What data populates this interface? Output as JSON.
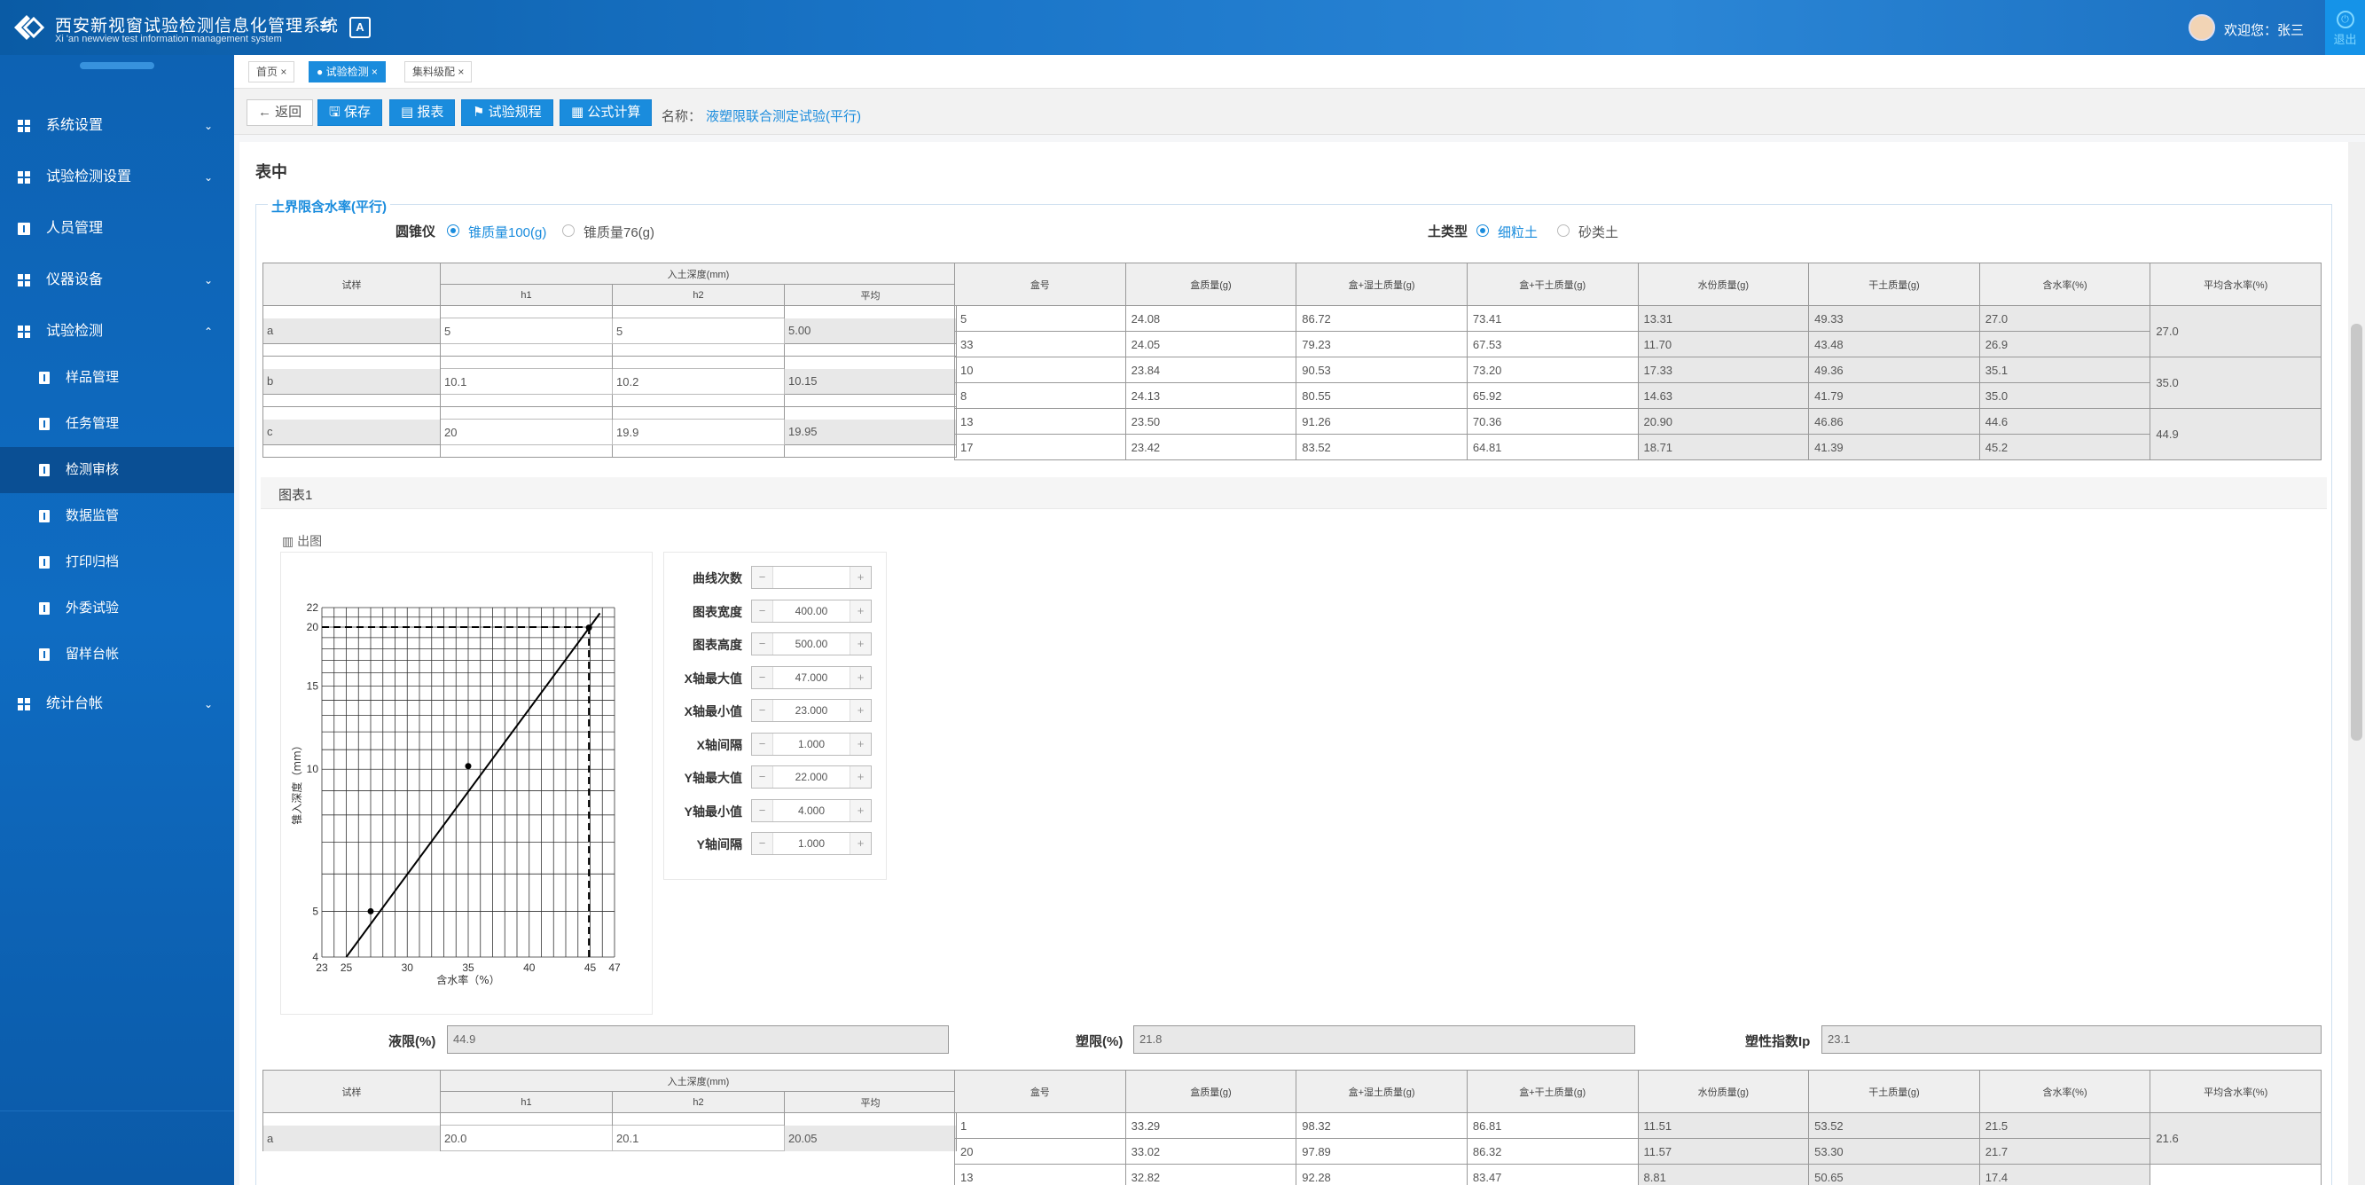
{
  "header": {
    "title": "西安新视窗试验检测信息化管理系统",
    "subtitle": "Xi 'an newview test information management system",
    "font_icon_text": "A",
    "welcome": "欢迎您：张三",
    "logout": "退出"
  },
  "sidebar": {
    "items": [
      {
        "label": "系统设置",
        "icon": "grid-icon",
        "chevron": "⌄"
      },
      {
        "label": "试验检测设置",
        "icon": "grid-icon",
        "chevron": "⌄"
      },
      {
        "label": "人员管理",
        "icon": "info-icon"
      },
      {
        "label": "仪器设备",
        "icon": "grid-icon",
        "chevron": "⌄"
      },
      {
        "label": "试验检测",
        "icon": "grid-icon",
        "chevron": "⌃"
      },
      {
        "label": "统计台帐",
        "icon": "grid-icon",
        "chevron": "⌄"
      }
    ],
    "sub_items": [
      {
        "label": "样品管理"
      },
      {
        "label": "任务管理"
      },
      {
        "label": "检测审核"
      },
      {
        "label": "数据监管"
      },
      {
        "label": "打印归档"
      },
      {
        "label": "外委试验"
      },
      {
        "label": "留样台帐"
      }
    ]
  },
  "tabs": [
    {
      "label": "首页 ×"
    },
    {
      "label": "● 试验检测 ×"
    },
    {
      "label": "集料级配 ×"
    }
  ],
  "toolbar": {
    "back": "← 返回",
    "save": "保存",
    "report": "报表",
    "rules": "试验规程",
    "formula": "公式计算",
    "name_label": "名称：",
    "name_value": "液塑限联合测定试验(平行)"
  },
  "section": {
    "title": "表中",
    "legend": "土界限含水率(平行)",
    "cone_label": "圆锥仪",
    "cone_options": [
      "锥质量100(g)",
      "锥质量76(g)"
    ],
    "soil_label": "土类型",
    "soil_options": [
      "细粒土",
      "砂类土"
    ]
  },
  "table1": {
    "header_left": {
      "sample": "试样",
      "depth": "入土深度(mm)",
      "h1": "h1",
      "h2": "h2",
      "avg": "平均"
    },
    "header_right": [
      "盒号",
      "盒质量(g)",
      "盒+湿土质量(g)",
      "盒+干土质量(g)",
      "水份质量(g)",
      "干土质量(g)",
      "含水率(%)",
      "平均含水率(%)"
    ],
    "samples": [
      {
        "name": "a",
        "h1": "5",
        "h2": "5",
        "avg": "5.00",
        "avg_w": "27.0",
        "rows": [
          [
            "5",
            "24.08",
            "86.72",
            "73.41",
            "13.31",
            "49.33",
            "27.0"
          ],
          [
            "33",
            "24.05",
            "79.23",
            "67.53",
            "11.70",
            "43.48",
            "26.9"
          ]
        ]
      },
      {
        "name": "b",
        "h1": "10.1",
        "h2": "10.2",
        "avg": "10.15",
        "avg_w": "35.0",
        "rows": [
          [
            "10",
            "23.84",
            "90.53",
            "73.20",
            "17.33",
            "49.36",
            "35.1"
          ],
          [
            "8",
            "24.13",
            "80.55",
            "65.92",
            "14.63",
            "41.79",
            "35.0"
          ]
        ]
      },
      {
        "name": "c",
        "h1": "20",
        "h2": "19.9",
        "avg": "19.95",
        "avg_w": "44.9",
        "rows": [
          [
            "13",
            "23.50",
            "91.26",
            "70.36",
            "20.90",
            "46.86",
            "44.6"
          ],
          [
            "17",
            "23.42",
            "83.52",
            "64.81",
            "18.71",
            "41.39",
            "45.2"
          ]
        ]
      }
    ]
  },
  "chart_section": {
    "title": "图表1",
    "plot_button": "出图"
  },
  "chart_data": {
    "type": "line",
    "xlabel": "含水率（%）",
    "ylabel": "锥入深度（mm）",
    "xlim": [
      23,
      47
    ],
    "ylim": [
      4,
      22
    ],
    "x_ticks": [
      23,
      25,
      30,
      35,
      40,
      45,
      47
    ],
    "y_ticks": [
      4,
      5,
      10,
      15,
      20,
      22
    ],
    "y_scale": "log",
    "grid": true,
    "points": [
      {
        "x": 27.0,
        "y": 5.0
      },
      {
        "x": 35.0,
        "y": 10.15
      },
      {
        "x": 44.9,
        "y": 19.95
      }
    ],
    "line": [
      {
        "x": 25.0,
        "y": 4.0
      },
      {
        "x": 45.8,
        "y": 21.4
      }
    ],
    "guide": {
      "x": 44.9,
      "y": 20
    }
  },
  "params": [
    {
      "label": "曲线次数",
      "value": ""
    },
    {
      "label": "图表宽度",
      "value": "400.00"
    },
    {
      "label": "图表高度",
      "value": "500.00"
    },
    {
      "label": "X轴最大值",
      "value": "47.000"
    },
    {
      "label": "X轴最小值",
      "value": "23.000"
    },
    {
      "label": "X轴间隔",
      "value": "1.000"
    },
    {
      "label": "Y轴最大值",
      "value": "22.000"
    },
    {
      "label": "Y轴最小值",
      "value": "4.000"
    },
    {
      "label": "Y轴间隔",
      "value": "1.000"
    }
  ],
  "limits": {
    "liquid_label": "液限(%)",
    "liquid_value": "44.9",
    "plastic_label": "塑限(%)",
    "plastic_value": "21.8",
    "index_label": "塑性指数Ip",
    "index_value": "23.1"
  },
  "table2": {
    "header_left": {
      "sample": "试样",
      "depth": "入土深度(mm)",
      "h1": "h1",
      "h2": "h2",
      "avg": "平均"
    },
    "header_right": [
      "盒号",
      "盒质量(g)",
      "盒+湿土质量(g)",
      "盒+干土质量(g)",
      "水份质量(g)",
      "干土质量(g)",
      "含水率(%)",
      "平均含水率(%)"
    ],
    "sample": {
      "name": "a",
      "h1": "20.0",
      "h2": "20.1",
      "avg": "20.05",
      "avg_w": "21.6",
      "rows": [
        [
          "1",
          "33.29",
          "98.32",
          "86.81",
          "11.51",
          "53.52",
          "21.5"
        ],
        [
          "20",
          "33.02",
          "97.89",
          "86.32",
          "11.57",
          "53.30",
          "21.7"
        ],
        [
          "13",
          "32.82",
          "92.28",
          "83.47",
          "8.81",
          "50.65",
          "17.4"
        ]
      ]
    }
  }
}
